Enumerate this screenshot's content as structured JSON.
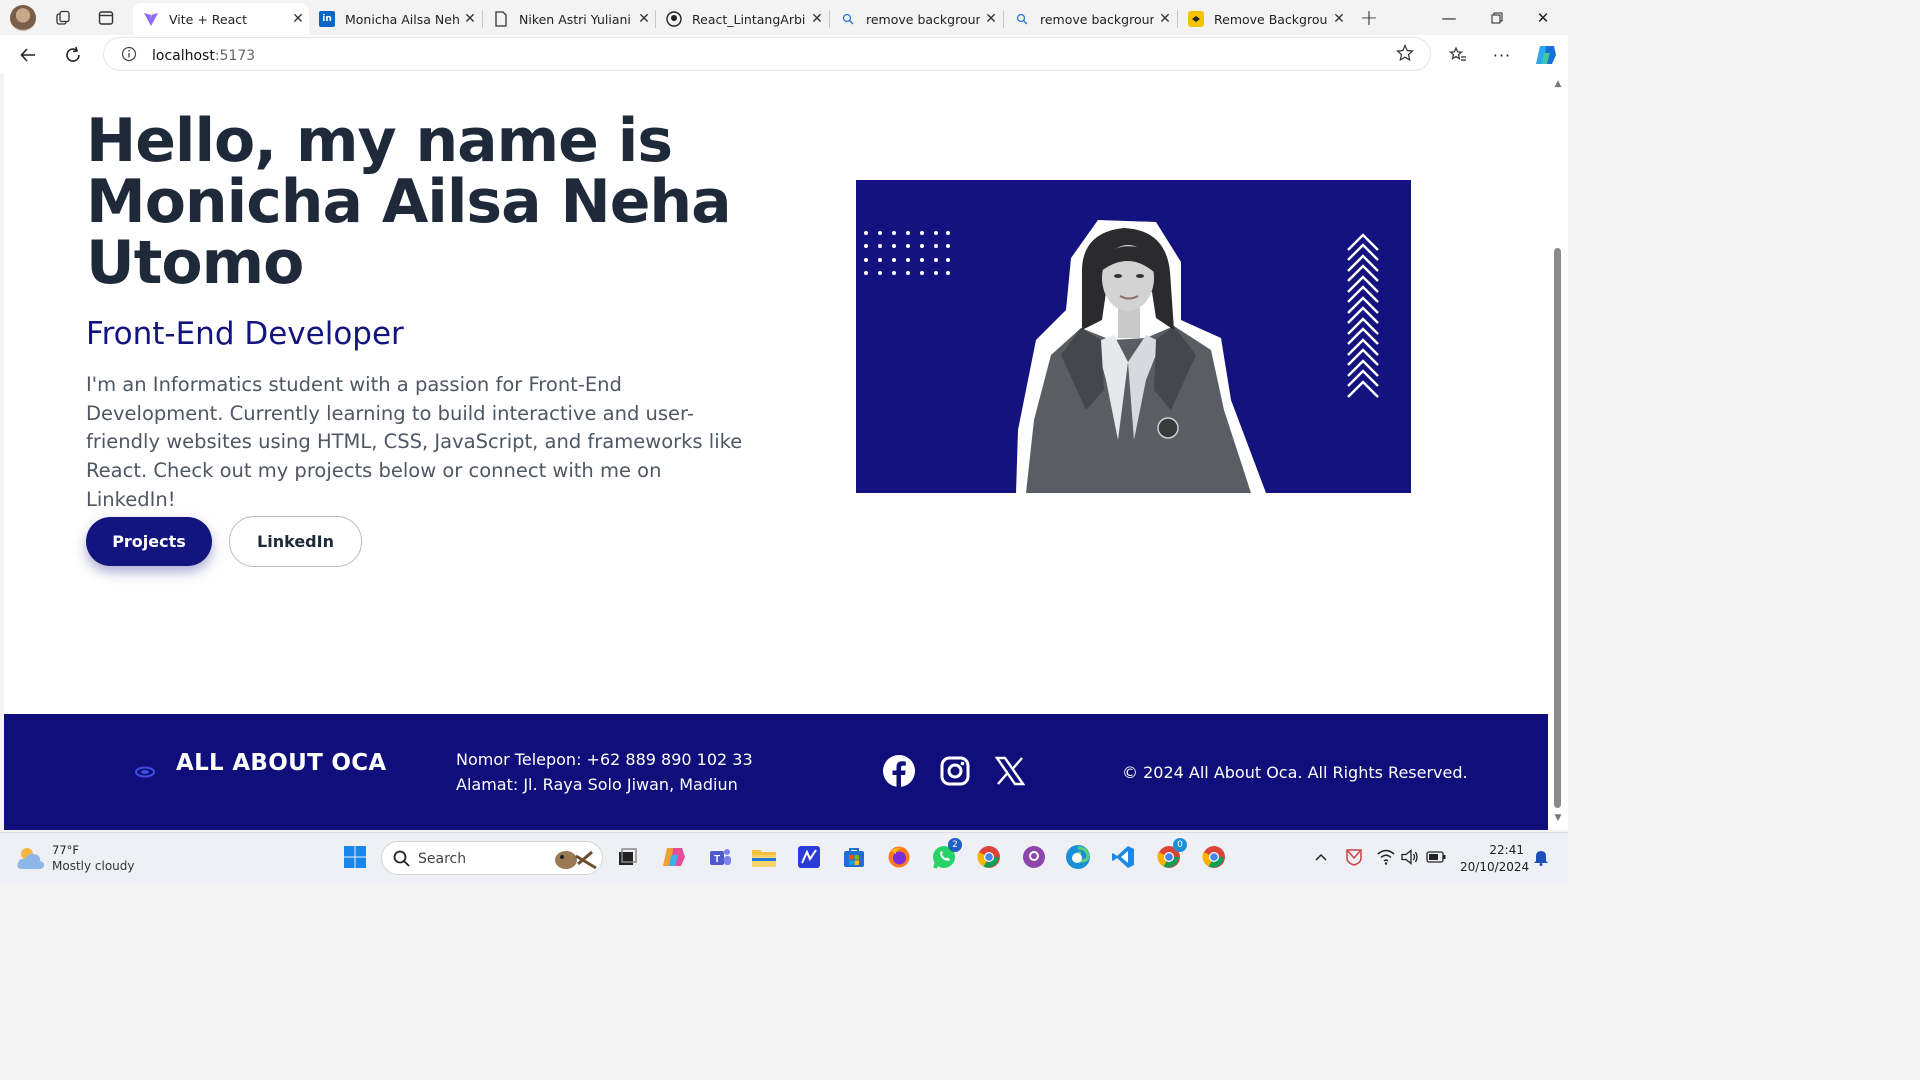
{
  "browser": {
    "tabs": [
      {
        "label": "Vite + React",
        "icon": "vite-icon",
        "active": true
      },
      {
        "label": "Monicha Ailsa Neha",
        "icon": "linkedin-icon",
        "active": false
      },
      {
        "label": "Niken Astri Yuliani -",
        "icon": "document-icon",
        "active": false
      },
      {
        "label": "React_LintangArbiSu",
        "icon": "github-icon",
        "active": false
      },
      {
        "label": "remove background",
        "icon": "search-icon",
        "active": false
      },
      {
        "label": "remove background",
        "icon": "search-icon",
        "active": false
      },
      {
        "label": "Remove Background",
        "icon": "remove-bg-icon",
        "active": false
      }
    ],
    "address": {
      "host": "localhost",
      "port": ":5173"
    }
  },
  "hero": {
    "title_lines": [
      "Hello, my name is",
      "Monicha Ailsa Neha",
      "Utomo"
    ],
    "role": "Front-End Developer",
    "bio": "I'm an Informatics student with a passion for Front-End Development. Currently learning to build interactive and user-friendly websites using HTML, CSS, JavaScript, and frameworks like React. Check out my projects below or connect with me on LinkedIn!",
    "buttons": {
      "projects": "Projects",
      "linkedin": "LinkedIn"
    }
  },
  "footer": {
    "brand": "ALL ABOUT OCA",
    "phone": "Nomor Telepon: +62 889 890 102 33",
    "address": "Alamat: Jl. Raya Solo Jiwan, Madiun",
    "social_icons": [
      "facebook-icon",
      "instagram-icon",
      "x-icon"
    ],
    "copyright": "© 2024 All About Oca. All Rights Reserved."
  },
  "taskbar": {
    "weather": {
      "temp": "77°F",
      "desc": "Mostly cloudy"
    },
    "search_placeholder": "Search",
    "badges": {
      "whatsapp": "2",
      "chrome_2": "0"
    },
    "clock": {
      "time": "22:41",
      "date": "20/10/2024"
    }
  },
  "colors": {
    "brand_navy": "#13127f",
    "footer_navy": "#0f0e7b",
    "heading": "#1e2a3a",
    "role": "#13157e"
  }
}
